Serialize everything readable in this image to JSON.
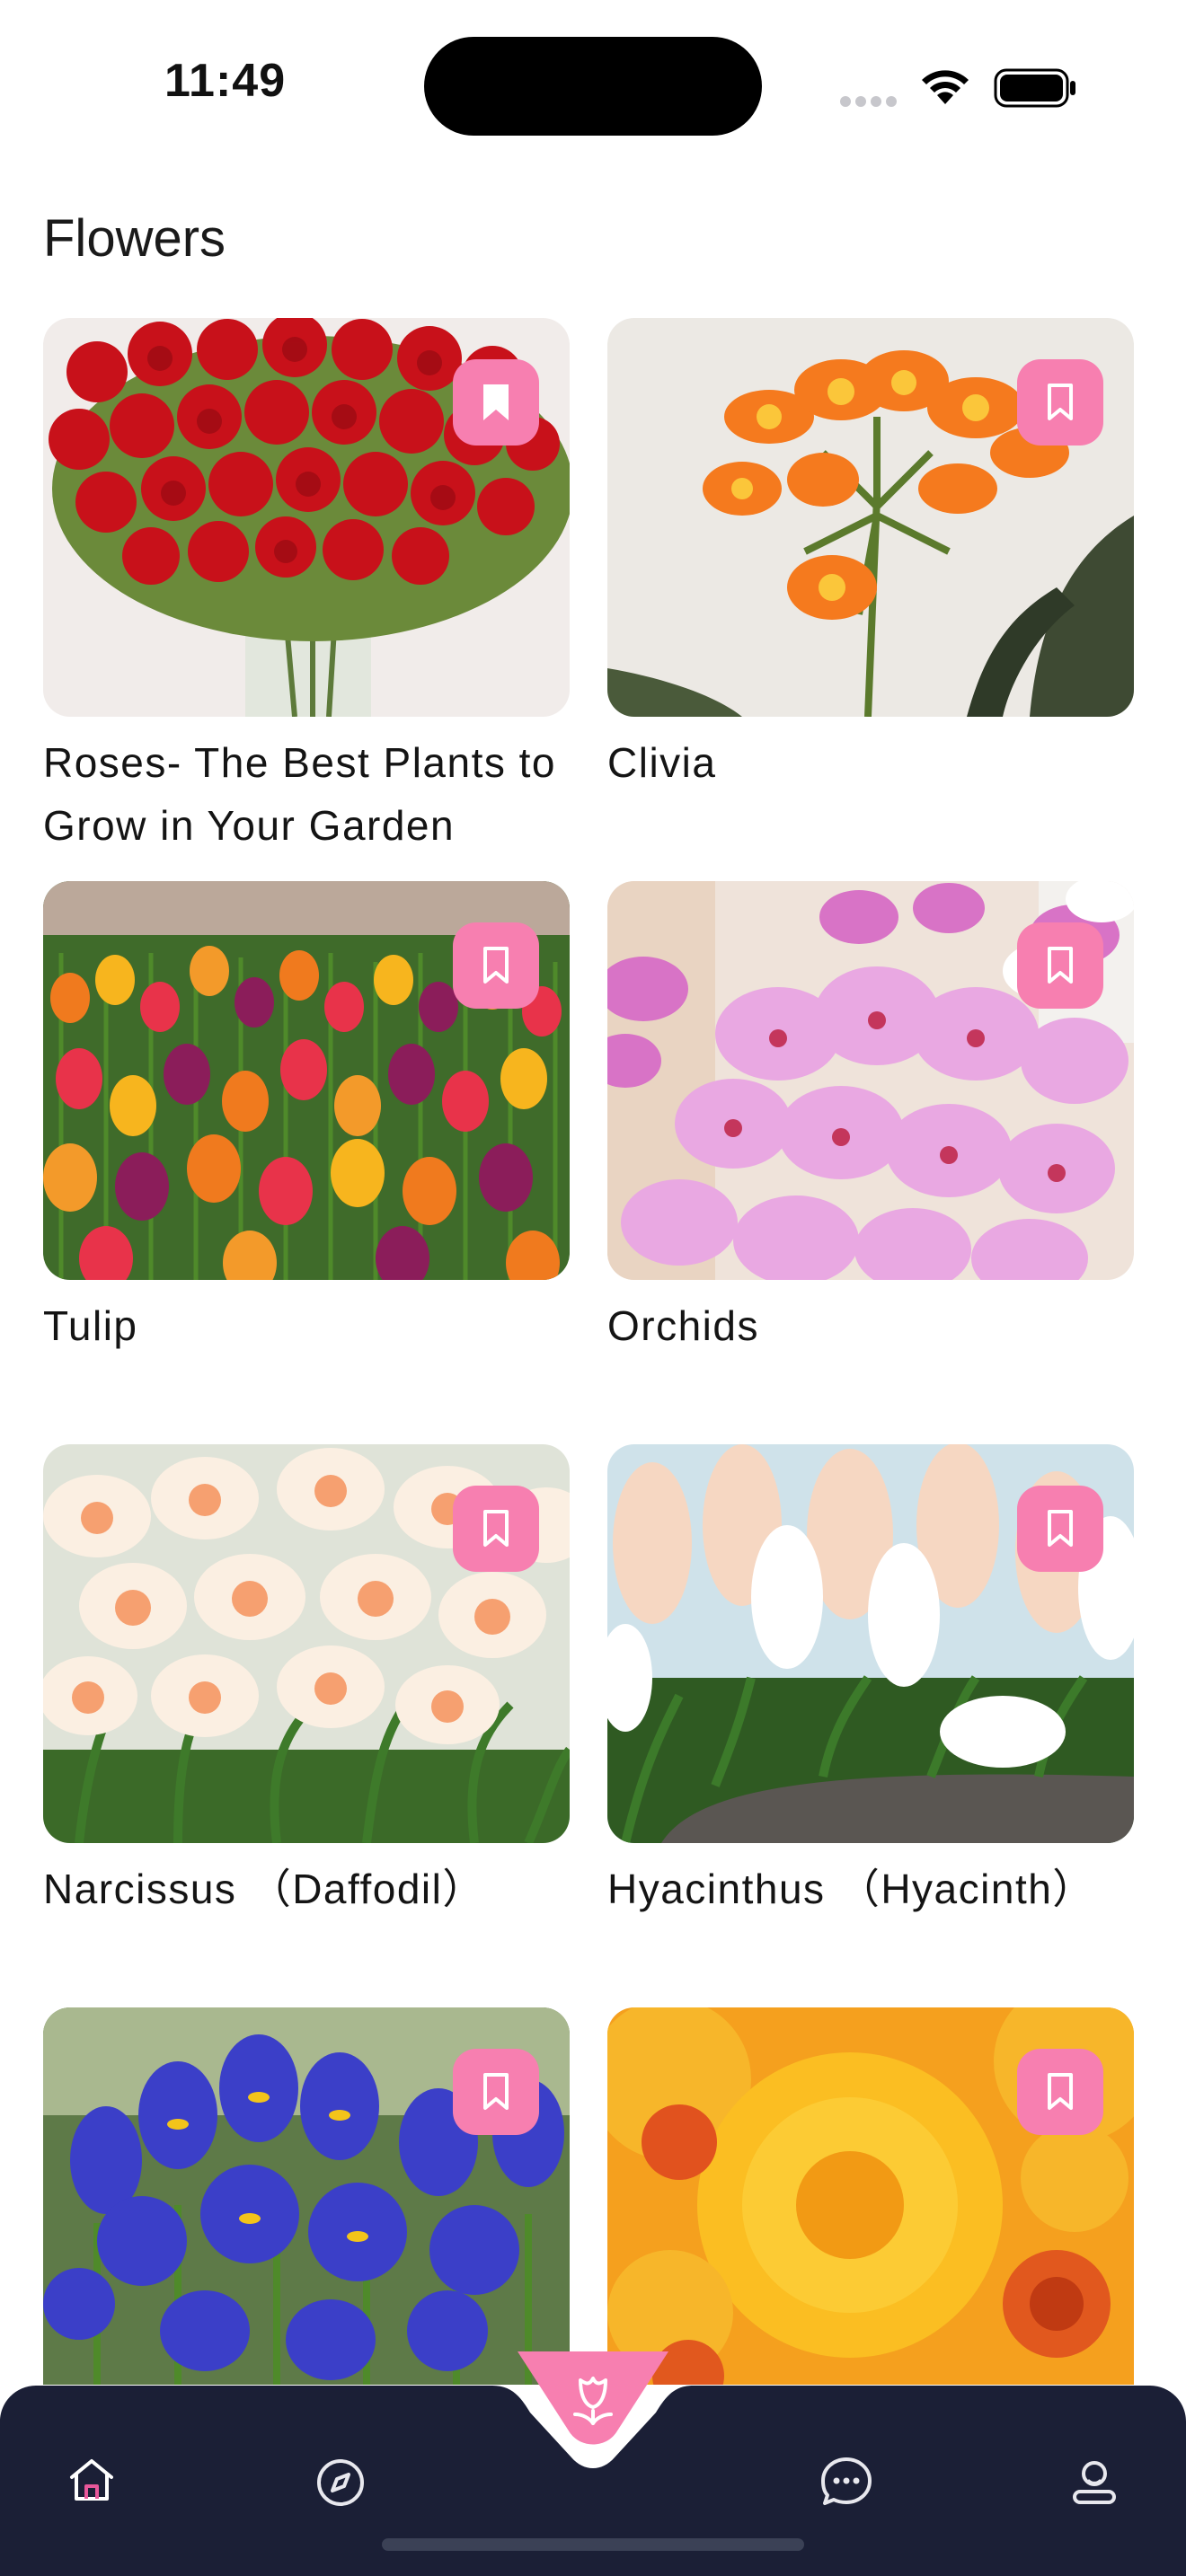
{
  "status_bar": {
    "time": "11:49"
  },
  "page": {
    "title": "Flowers"
  },
  "cards": [
    {
      "title": "Roses- The Best Plants to Grow in Your Garden",
      "bookmarked": true
    },
    {
      "title": "Clivia",
      "bookmarked": false
    },
    {
      "title": "Tulip",
      "bookmarked": false
    },
    {
      "title": "Orchids",
      "bookmarked": false
    },
    {
      "title": "Narcissus （Daffodil）",
      "bookmarked": false
    },
    {
      "title": "Hyacinthus （Hyacinth）",
      "bookmarked": false
    },
    {
      "title": "",
      "bookmarked": false
    },
    {
      "title": "",
      "bookmarked": false
    }
  ],
  "nav": {
    "items": [
      "home-icon",
      "compass-icon",
      "flower-icon",
      "chat-icon",
      "profile-icon"
    ],
    "active": "home-icon"
  },
  "colors": {
    "accent": "#f77fb0",
    "nav_bg": "#1b1f36",
    "active_icon": "#e8579a"
  }
}
